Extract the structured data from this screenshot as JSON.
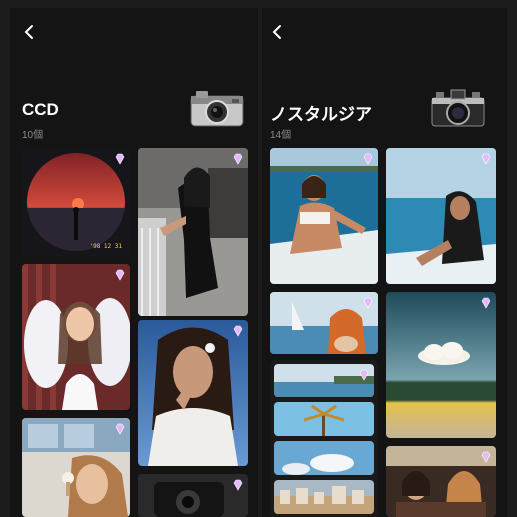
{
  "left_panel": {
    "title": "CCD",
    "count": "10個",
    "icons": {
      "back": "chevron-left-icon",
      "camera": "ccd-camera-icon",
      "badge": "gem-icon"
    },
    "photos": [
      {
        "name": "sunset-circle-photo"
      },
      {
        "name": "balcony-portrait-photo"
      },
      {
        "name": "balloons-portrait-photo"
      },
      {
        "name": "flower-hair-portrait-photo"
      },
      {
        "name": "ice-cream-portrait-photo"
      },
      {
        "name": "camera-closeup-photo"
      }
    ],
    "overlays": {
      "date": "'98 12 31"
    }
  },
  "right_panel": {
    "title": "ノスタルジア",
    "count": "14個",
    "icons": {
      "back": "chevron-left-icon",
      "camera": "film-camera-icon",
      "badge": "gem-icon"
    },
    "photos": [
      {
        "name": "boat-sunglasses-photo"
      },
      {
        "name": "sea-boat-photo"
      },
      {
        "name": "sailboat-hair-photo"
      },
      {
        "name": "cloud-sea-photo"
      },
      {
        "name": "shore-strip-photo"
      },
      {
        "name": "palm-tree-strip-photo"
      },
      {
        "name": "sky-cloud-strip-photo"
      },
      {
        "name": "town-strip-photo"
      },
      {
        "name": "friends-photo"
      }
    ]
  },
  "colors": {
    "panel_bg": "#141414",
    "page_bg": "#1c1c1c",
    "count_text": "#8a8a8a",
    "gem": "#d9a8ff"
  }
}
